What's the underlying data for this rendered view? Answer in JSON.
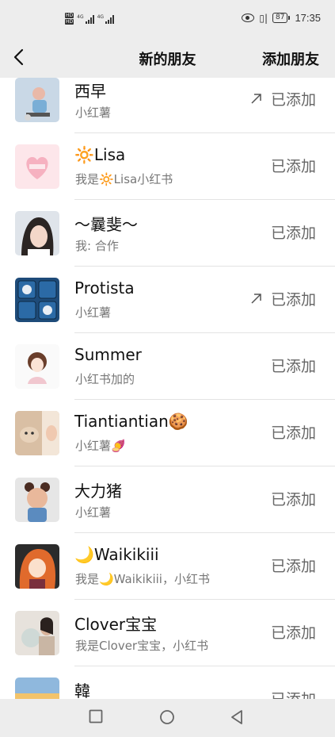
{
  "status_bar": {
    "network_label_1": "HD",
    "network_label_2": "HD",
    "signal_1_label": "4G",
    "signal_2_label": "4G",
    "battery": "87",
    "time": "17:35",
    "vibrate_symbol": "▯|"
  },
  "nav": {
    "title": "新的朋友",
    "action": "添加朋友"
  },
  "friends": [
    {
      "name": "西早",
      "sub": "小红薯",
      "status": "已添加",
      "forwarded": true
    },
    {
      "name": "🔆Lisa",
      "sub": "我是🔆Lisa小红书",
      "status": "已添加",
      "forwarded": false
    },
    {
      "name": "～曩斐～",
      "sub": "我: 合作",
      "status": "已添加",
      "forwarded": false
    },
    {
      "name": "Protista",
      "sub": "小红薯",
      "status": "已添加",
      "forwarded": true
    },
    {
      "name": "Summer",
      "sub": "小红书加的",
      "status": "已添加",
      "forwarded": false
    },
    {
      "name": "Tiantiantian🍪",
      "sub": "小红薯🍠",
      "status": "已添加",
      "forwarded": false
    },
    {
      "name": "大力猪",
      "sub": "小红薯",
      "status": "已添加",
      "forwarded": false
    },
    {
      "name": "🌙Waikikiii",
      "sub": "我是🌙Waikikiii，小红书",
      "status": "已添加",
      "forwarded": false
    },
    {
      "name": "Clover宝宝",
      "sub": "我是Clover宝宝，小红书",
      "status": "已添加",
      "forwarded": false
    },
    {
      "name": "韓",
      "sub": "",
      "status": "已添加",
      "forwarded": false
    }
  ],
  "colors": {
    "background": "#ededed",
    "list_bg": "#ffffff",
    "status_text": "#666666",
    "sub_text": "#777777"
  },
  "icons": {
    "back": "chevron-left-icon",
    "forward": "arrow-up-right-icon",
    "home": "circle-home-icon",
    "recents": "square-recents-icon",
    "back_nav": "triangle-back-icon"
  }
}
